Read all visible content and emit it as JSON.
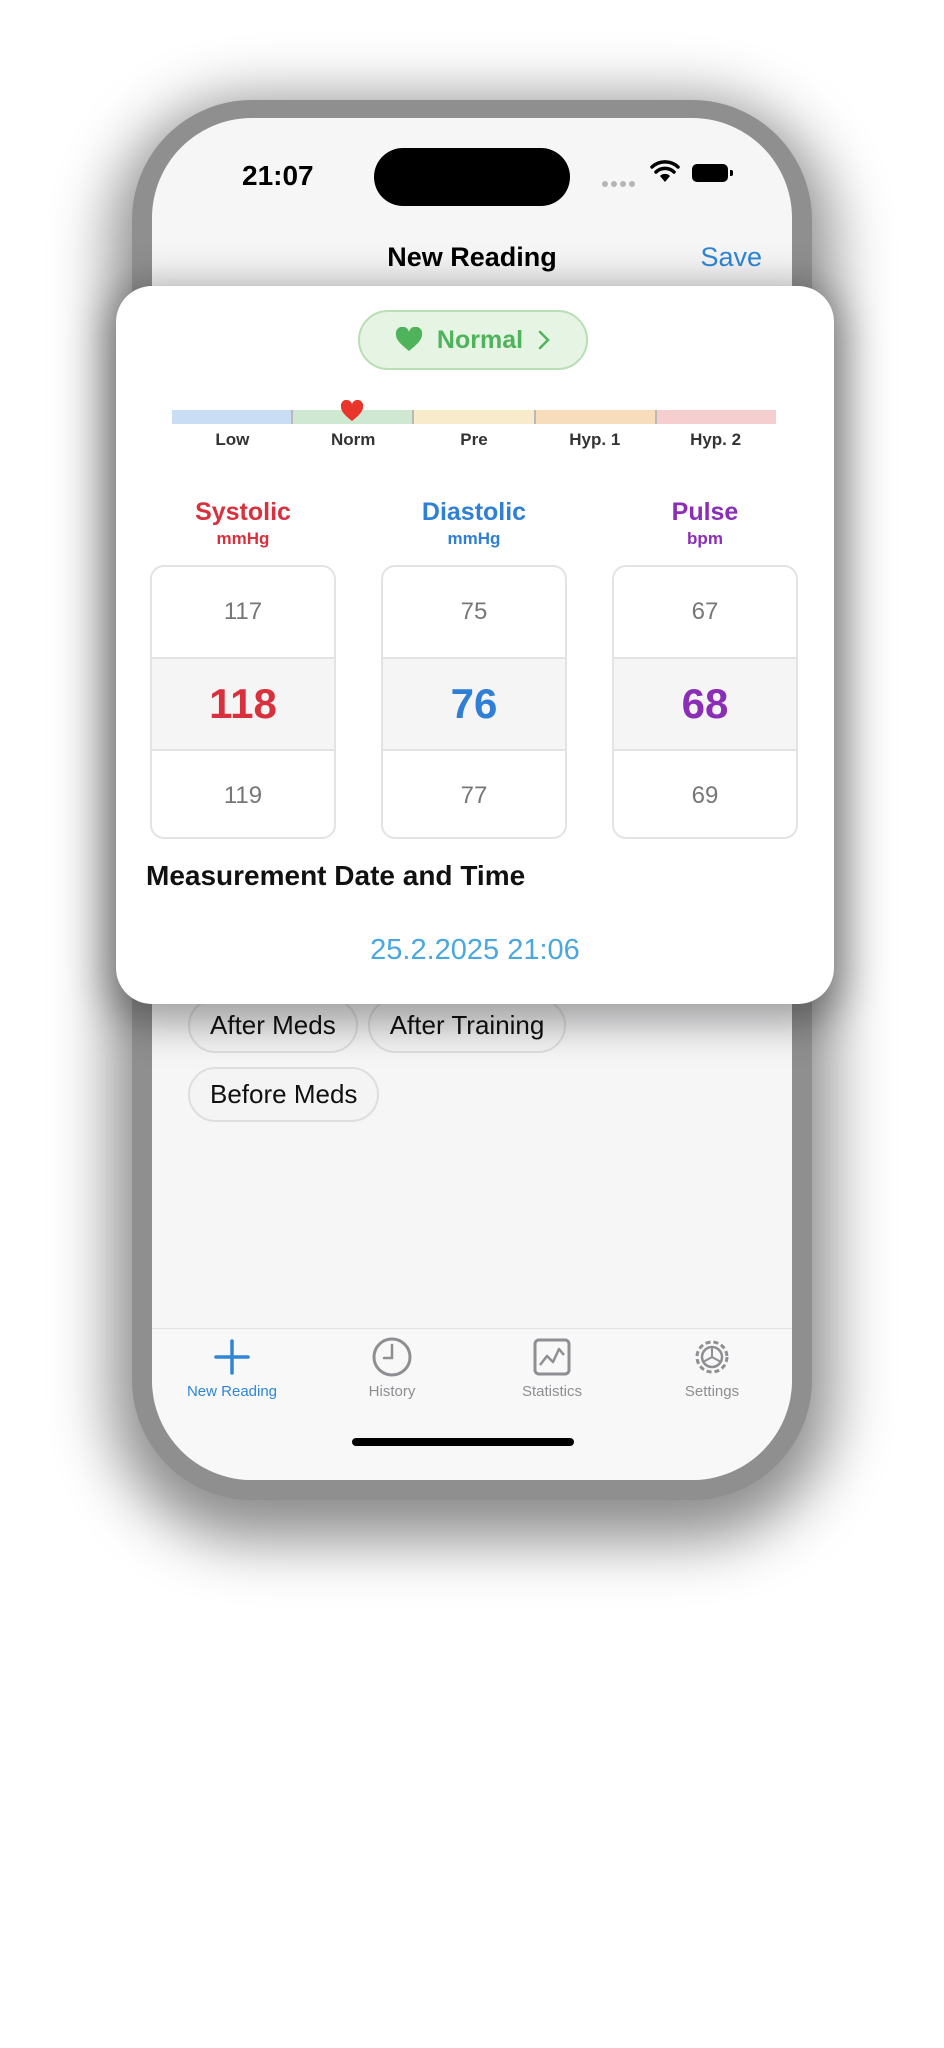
{
  "status_bar": {
    "time": "21:07"
  },
  "nav": {
    "title": "New Reading",
    "save": "Save"
  },
  "badge": {
    "label": "Normal",
    "color": "#4fb35b"
  },
  "scale": {
    "labels": [
      "Low",
      "Norm",
      "Pre",
      "Hyp. 1",
      "Hyp. 2"
    ],
    "colors": [
      "#c9def4",
      "#cfe8d2",
      "#f8ebcb",
      "#f8ddbd",
      "#f5cfcf"
    ],
    "current": "Norm"
  },
  "readings": {
    "systolic": {
      "title": "Systolic",
      "unit": "mmHg",
      "above": "117",
      "value": "118",
      "below": "119",
      "color": "#d8313d"
    },
    "diastolic": {
      "title": "Diastolic",
      "unit": "mmHg",
      "above": "75",
      "value": "76",
      "below": "77",
      "color": "#2f7fd6"
    },
    "pulse": {
      "title": "Pulse",
      "unit": "bpm",
      "above": "67",
      "value": "68",
      "below": "69",
      "color": "#8a2fb5"
    }
  },
  "measurement": {
    "title": "Measurement Date and Time",
    "datetime": "25.2.2025 21:06"
  },
  "tags": [
    "After Meds",
    "After Training",
    "Before Meds"
  ],
  "tabs": [
    {
      "label": "New Reading",
      "icon": "plus-icon",
      "active": true
    },
    {
      "label": "History",
      "icon": "clock-icon",
      "active": false
    },
    {
      "label": "Statistics",
      "icon": "chart-icon",
      "active": false
    },
    {
      "label": "Settings",
      "icon": "gear-icon",
      "active": false
    }
  ],
  "accent": "#2f86d6"
}
